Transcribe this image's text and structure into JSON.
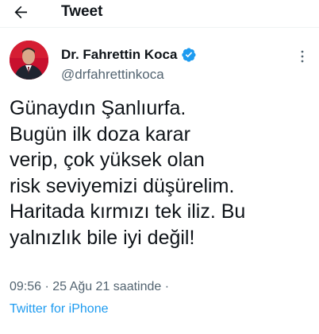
{
  "header": {
    "title": "Tweet",
    "back_icon": "arrow-left-icon"
  },
  "author": {
    "name": "Dr. Fahrettin Koca",
    "handle": "@drfahrettinkoca",
    "verified_icon": "verified-badge-icon",
    "verified_color": "#1d9bf0",
    "avatar_bg": "#c8102e"
  },
  "tweet": {
    "lines": [
      "Günaydın Şanlıurfa.",
      "Bugün ilk doza karar",
      "verip, çok yüksek olan",
      "risk seviyemizi düşürelim.",
      "Haritada kırmızı tek iliz. Bu",
      "yalnızlık bile iyi değil!"
    ],
    "time": "09:56",
    "separator": "·",
    "date": "25 Ağu 21 saatinde",
    "trailing_separator": "·",
    "source": "Twitter for iPhone"
  },
  "colors": {
    "link": "#1d9bf0",
    "secondary": "#536471",
    "text": "#0f1419"
  }
}
